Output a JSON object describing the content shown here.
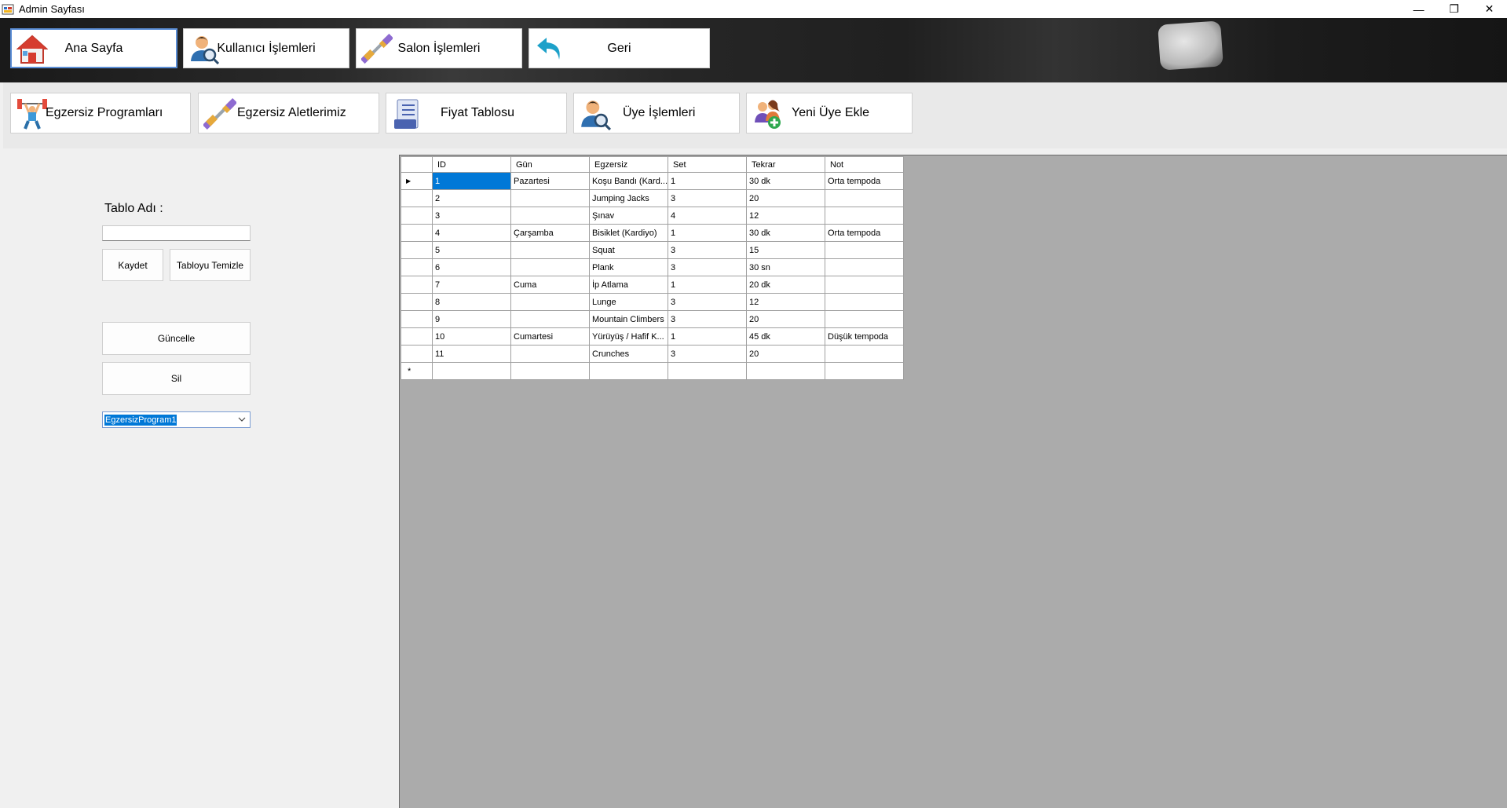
{
  "window": {
    "title": "Admin Sayfası",
    "controls": [
      "—",
      "❐",
      "✕"
    ]
  },
  "top_nav": [
    {
      "label": "Ana Sayfa",
      "icon": "home-icon"
    },
    {
      "label": "Kullanıcı İşlemleri",
      "icon": "user-search-icon"
    },
    {
      "label": "Salon İşlemleri",
      "icon": "dumbbell-icon"
    },
    {
      "label": "Geri",
      "icon": "back-arrow-icon"
    }
  ],
  "section_nav": [
    {
      "label": "Egzersiz Programları",
      "icon": "weightlifter-icon"
    },
    {
      "label": "Egzersiz Aletlerimiz",
      "icon": "dumbbell-icon"
    },
    {
      "label": "Fiyat Tablosu",
      "icon": "document-list-icon"
    },
    {
      "label": "Üye İşlemleri",
      "icon": "user-search-icon"
    },
    {
      "label": "Yeni Üye Ekle",
      "icon": "add-users-icon"
    }
  ],
  "form": {
    "table_name_label": "Tablo Adı :",
    "table_name_value": "",
    "save_label": "Kaydet",
    "clear_label": "Tabloyu Temizle",
    "update_label": "Güncelle",
    "delete_label": "Sil",
    "program_select": "EgzersizProgram1"
  },
  "grid": {
    "columns": [
      "ID",
      "Gün",
      "Egzersiz",
      "Set",
      "Tekrar",
      "Not"
    ],
    "current_row_marker": "▶",
    "new_row_marker": "*",
    "rows": [
      [
        "1",
        "Pazartesi",
        "Koşu Bandı (Kard...",
        "1",
        "30 dk",
        "Orta tempoda"
      ],
      [
        "2",
        "",
        "Jumping Jacks",
        "3",
        "20",
        ""
      ],
      [
        "3",
        "",
        "Şınav",
        "4",
        "12",
        ""
      ],
      [
        "4",
        "Çarşamba",
        "Bisiklet (Kardiyo)",
        "1",
        "30 dk",
        "Orta tempoda"
      ],
      [
        "5",
        "",
        "Squat",
        "3",
        "15",
        ""
      ],
      [
        "6",
        "",
        "Plank",
        "3",
        "30 sn",
        ""
      ],
      [
        "7",
        "Cuma",
        "İp Atlama",
        "1",
        "20 dk",
        ""
      ],
      [
        "8",
        "",
        "Lunge",
        "3",
        "12",
        ""
      ],
      [
        "9",
        "",
        "Mountain Climbers",
        "3",
        "20",
        ""
      ],
      [
        "10",
        "Cumartesi",
        "Yürüyüş / Hafif K...",
        "1",
        "45 dk",
        "Düşük tempoda"
      ],
      [
        "11",
        "",
        "Crunches",
        "3",
        "20",
        ""
      ]
    ]
  },
  "colors": {
    "selection": "#0078d7",
    "grid_background": "#ababab",
    "active_border": "#5b8ed6"
  }
}
